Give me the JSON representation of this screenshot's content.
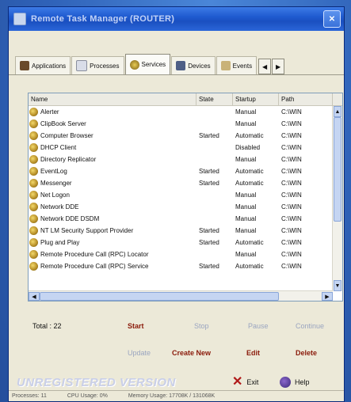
{
  "window": {
    "title": "Remote Task Manager (ROUTER)"
  },
  "tabs": [
    {
      "label": "Applications"
    },
    {
      "label": "Processes"
    },
    {
      "label": "Services",
      "active": true
    },
    {
      "label": "Devices"
    },
    {
      "label": "Events"
    }
  ],
  "columns": {
    "name": "Name",
    "state": "State",
    "startup": "Startup",
    "path": "Path"
  },
  "services": [
    {
      "name": "Alerter",
      "state": "",
      "startup": "Manual",
      "path": "C:\\WIN"
    },
    {
      "name": "ClipBook Server",
      "state": "",
      "startup": "Manual",
      "path": "C:\\WIN"
    },
    {
      "name": "Computer Browser",
      "state": "Started",
      "startup": "Automatic",
      "path": "C:\\WIN"
    },
    {
      "name": "DHCP Client",
      "state": "",
      "startup": "Disabled",
      "path": "C:\\WIN"
    },
    {
      "name": "Directory Replicator",
      "state": "",
      "startup": "Manual",
      "path": "C:\\WIN"
    },
    {
      "name": "EventLog",
      "state": "Started",
      "startup": "Automatic",
      "path": "C:\\WIN"
    },
    {
      "name": "Messenger",
      "state": "Started",
      "startup": "Automatic",
      "path": "C:\\WIN"
    },
    {
      "name": "Net Logon",
      "state": "",
      "startup": "Manual",
      "path": "C:\\WIN"
    },
    {
      "name": "Network DDE",
      "state": "",
      "startup": "Manual",
      "path": "C:\\WIN"
    },
    {
      "name": "Network DDE DSDM",
      "state": "",
      "startup": "Manual",
      "path": "C:\\WIN"
    },
    {
      "name": "NT LM Security Support Provider",
      "state": "Started",
      "startup": "Manual",
      "path": "C:\\WIN"
    },
    {
      "name": "Plug and Play",
      "state": "Started",
      "startup": "Automatic",
      "path": "C:\\WIN"
    },
    {
      "name": "Remote Procedure Call (RPC) Locator",
      "state": "",
      "startup": "Manual",
      "path": "C:\\WIN"
    },
    {
      "name": "Remote Procedure Call (RPC) Service",
      "state": "Started",
      "startup": "Automatic",
      "path": "C:\\WIN"
    }
  ],
  "summary": {
    "total": "Total : 22"
  },
  "actions": {
    "start": "Start",
    "stop": "Stop",
    "pause": "Pause",
    "continue": "Continue",
    "update": "Update",
    "create_new": "Create New",
    "edit": "Edit",
    "delete": "Delete"
  },
  "footer": {
    "unregistered": "UNREGISTERED VERSION",
    "exit": "Exit",
    "help": "Help"
  },
  "status": {
    "processes": "Processes: 11",
    "cpu": "CPU Usage: 0%",
    "memory": "Memory Usage: 17708K / 131068K"
  },
  "colors": {
    "accent": "#1f5bd0",
    "action_enabled": "#8a1a0a",
    "action_disabled": "#9aa5c0"
  }
}
